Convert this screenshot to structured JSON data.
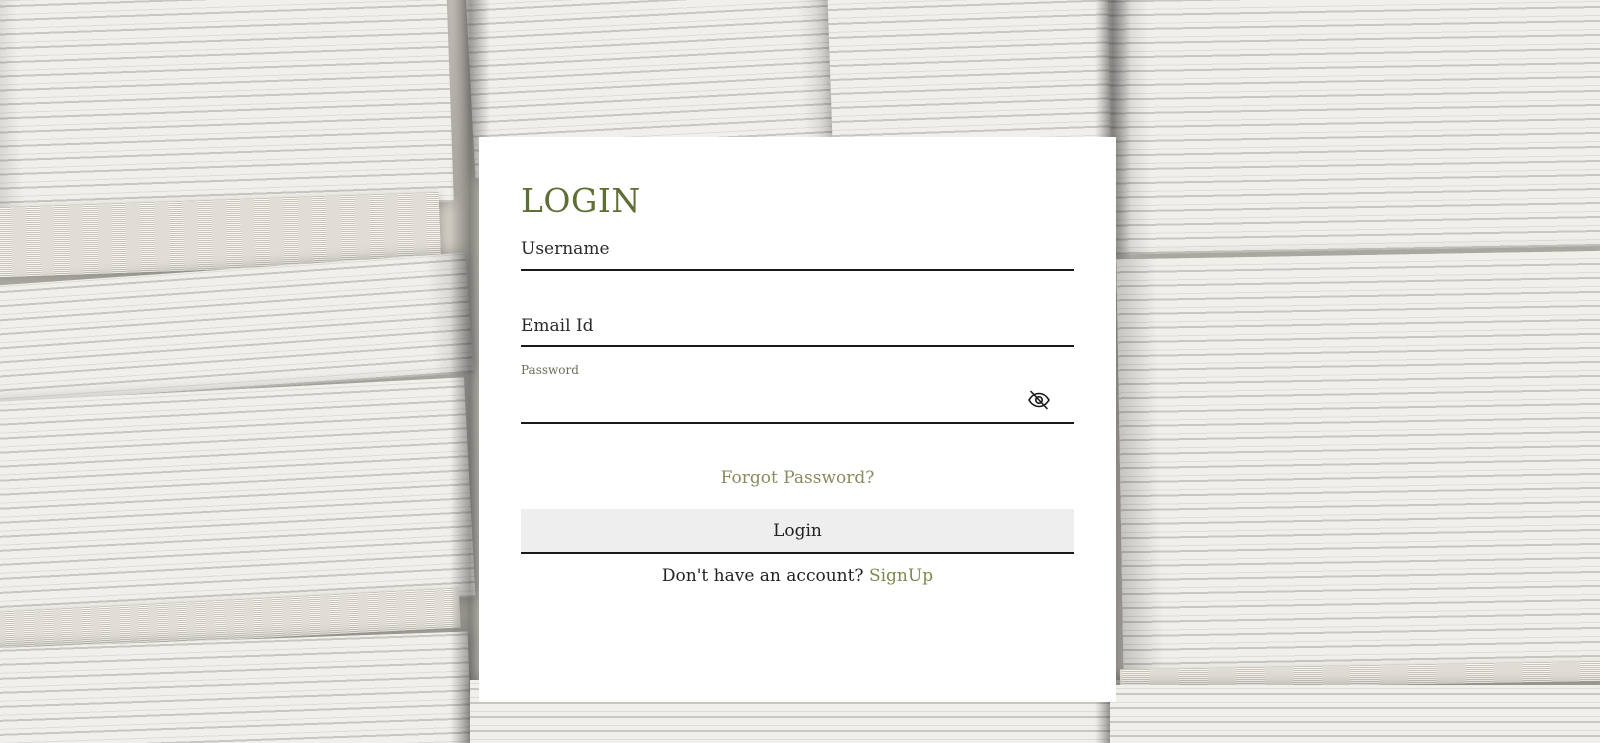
{
  "login": {
    "title": "LOGIN",
    "username_placeholder": "Username",
    "email_placeholder": "Email Id",
    "password_label": "Password",
    "password_value": "",
    "password_toggle_icon": "eye-slash-icon",
    "forgot_password": "Forgot Password?",
    "login_button": "Login",
    "no_account_text": "Don't have an account?",
    "signup_link": "SignUp"
  },
  "colors": {
    "title": "#5e6e35",
    "forgot_link": "#8b8a5e",
    "signup_link": "#7a8a4e",
    "button_bg": "#eeeeee",
    "card_bg": "#ffffff"
  }
}
